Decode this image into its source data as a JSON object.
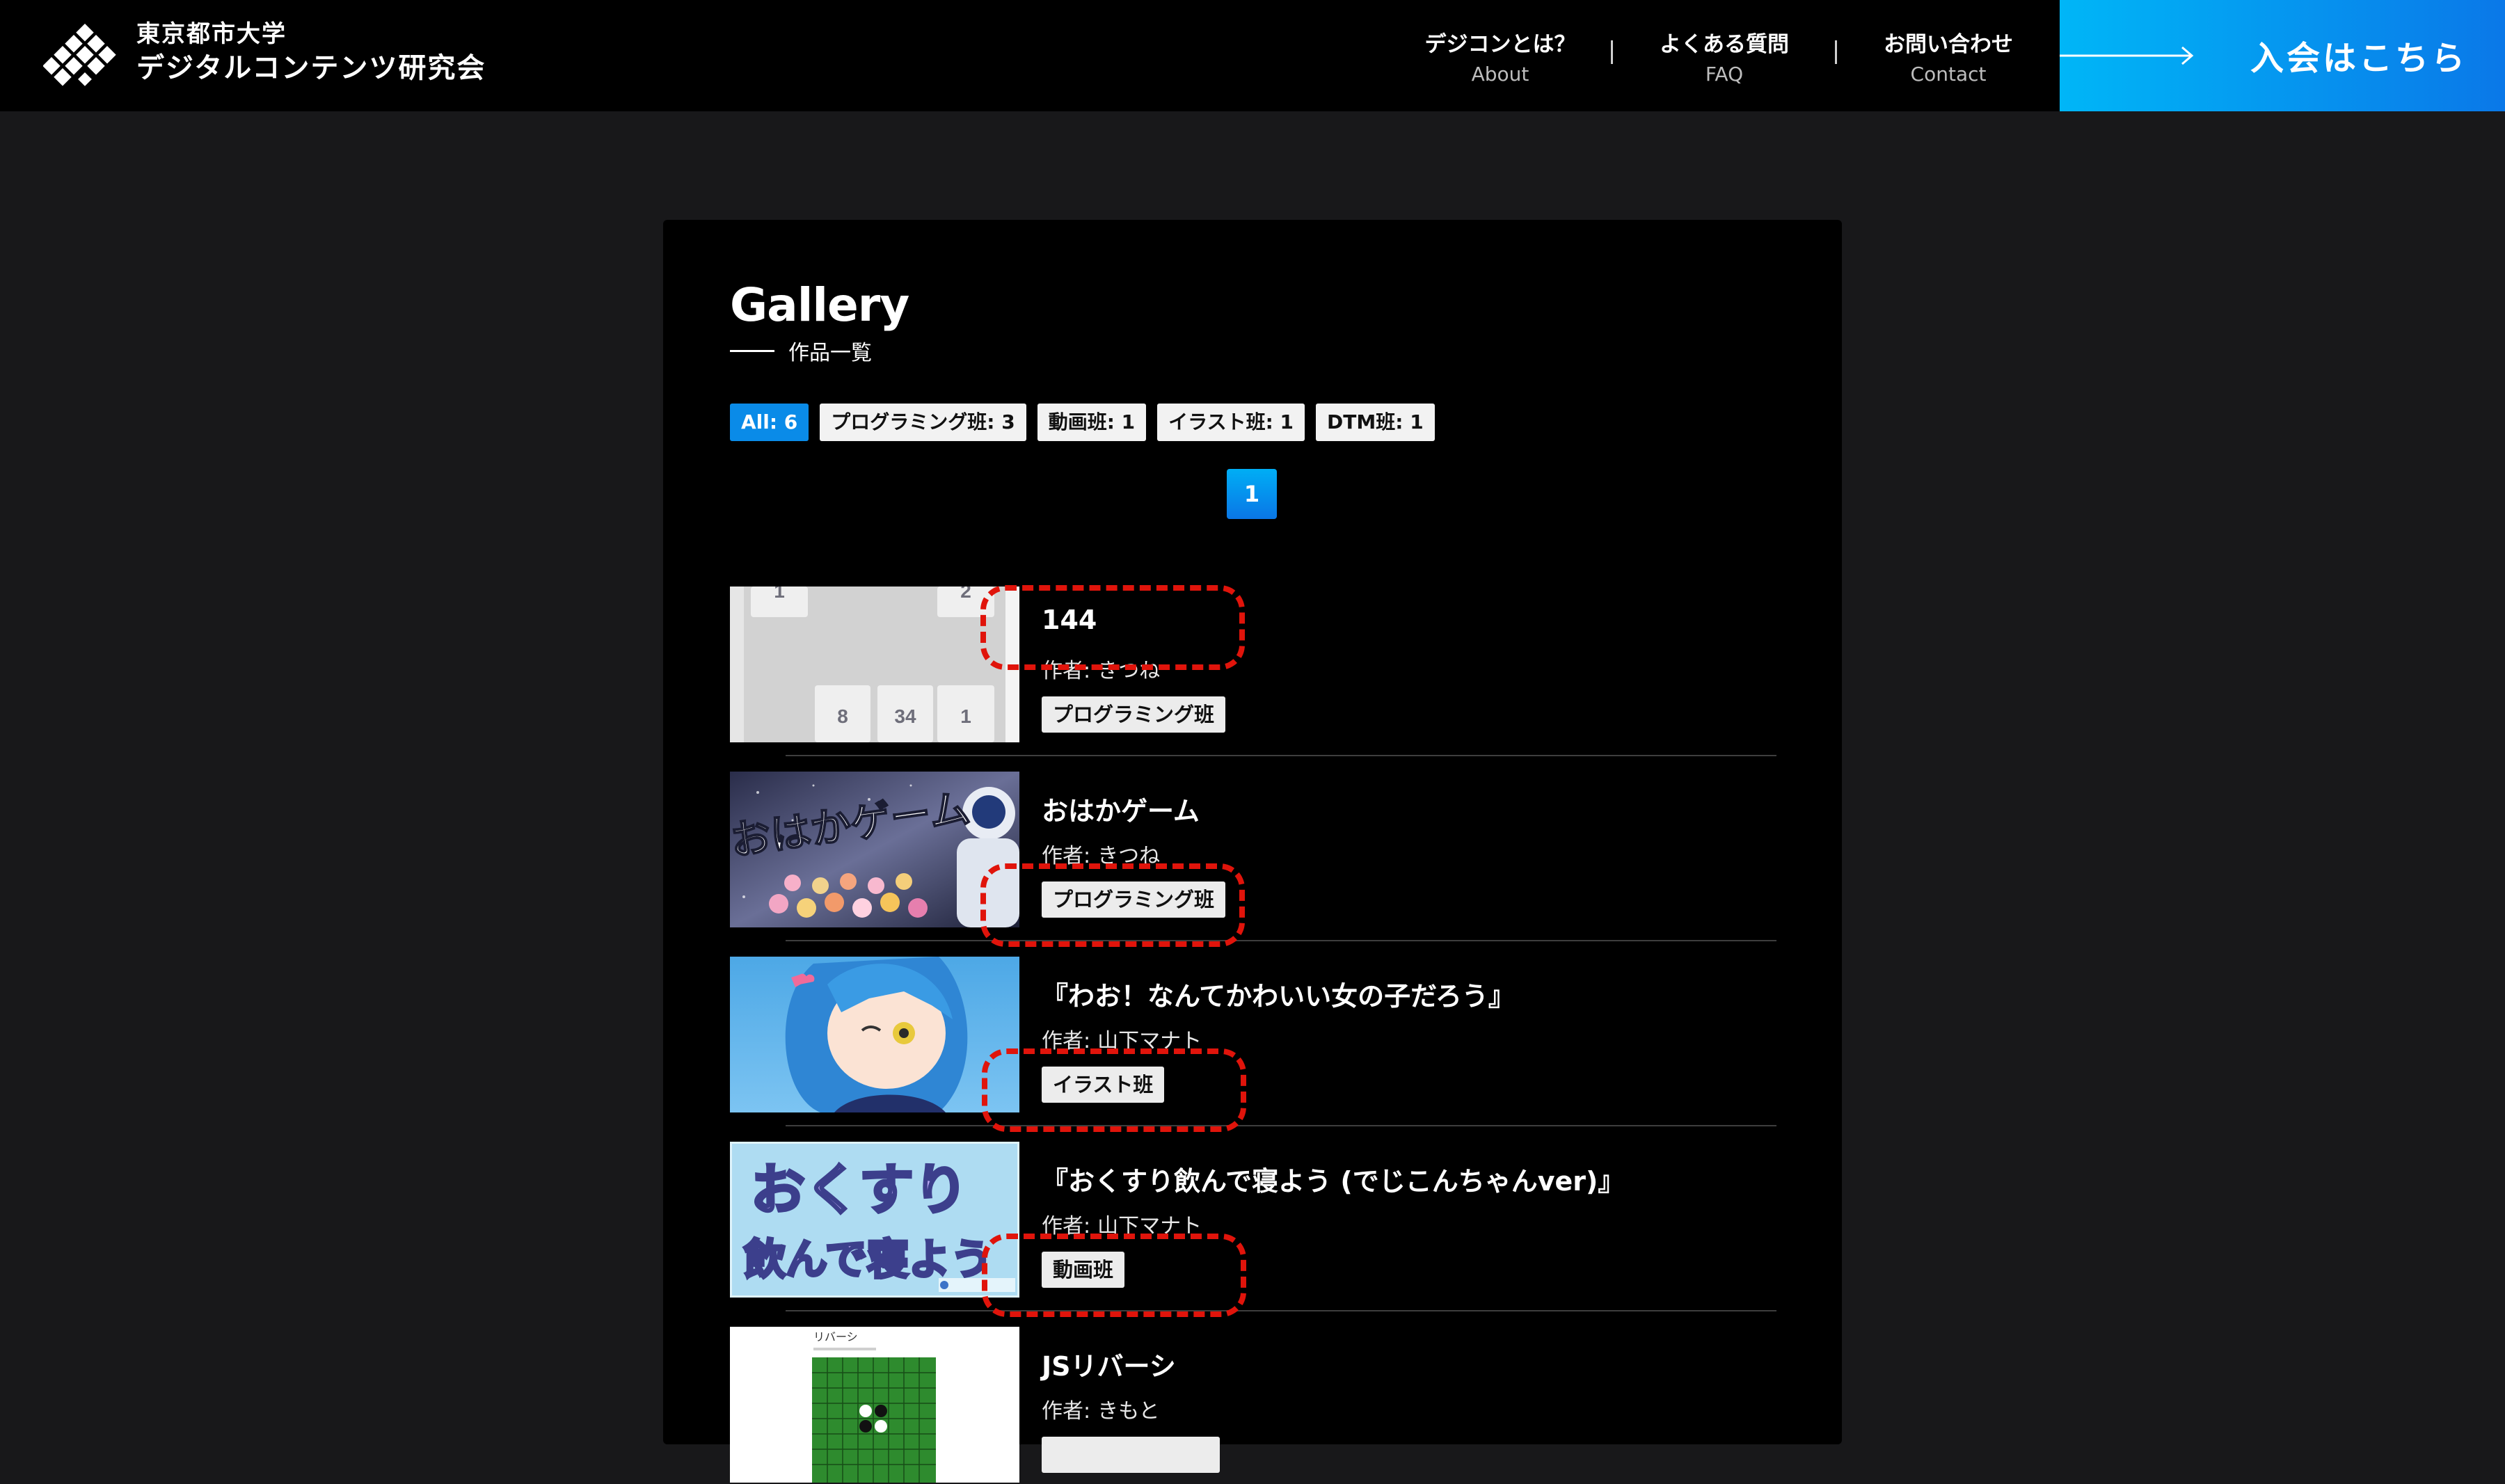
{
  "header": {
    "logo_line1": "東京都市大学",
    "logo_line2": "デジタルコンテンツ研究会",
    "nav": [
      {
        "ja": "デジコンとは？",
        "en": "About"
      },
      {
        "ja": "よくある質問",
        "en": "FAQ"
      },
      {
        "ja": "お問い合わせ",
        "en": "Contact"
      }
    ],
    "nav_separator": "|",
    "join_label": "入会はこちら"
  },
  "gallery": {
    "title": "Gallery",
    "subtitle": "作品一覧",
    "filters": [
      {
        "label": "All: 6",
        "active": true
      },
      {
        "label": "プログラミング班: 3",
        "active": false
      },
      {
        "label": "動画班: 1",
        "active": false
      },
      {
        "label": "イラスト班: 1",
        "active": false
      },
      {
        "label": "DTM班: 1",
        "active": false
      }
    ],
    "current_page": "1",
    "author_prefix": "作者:",
    "items": [
      {
        "title": "144",
        "author": "きつね",
        "tag": "プログラミング班",
        "thumb_tiles": [
          "1",
          "2",
          "8",
          "34",
          "1"
        ]
      },
      {
        "title": "おはかゲーム",
        "author": "きつね",
        "tag": "プログラミング班",
        "thumb_text": "おはかゲーム"
      },
      {
        "title": "『わお！なんてかわいい女の子だろう』",
        "author": "山下マナト",
        "tag": "イラスト班"
      },
      {
        "title": "『おくすり飲んで寝よう (でじこんちゃんver)』",
        "author": "山下マナト",
        "tag": "動画班",
        "thumb_text_1": "おくすり",
        "thumb_text_2": "飲んで寝よう"
      },
      {
        "title": "JSリバーシ",
        "author": "きもと",
        "tag": "",
        "thumb_text": "リバーシ"
      }
    ]
  },
  "colors": {
    "page_bg": "#18181a",
    "card_bg": "#000000",
    "accent_blue": "#0a8be8",
    "annotation_red": "#e0140b"
  }
}
